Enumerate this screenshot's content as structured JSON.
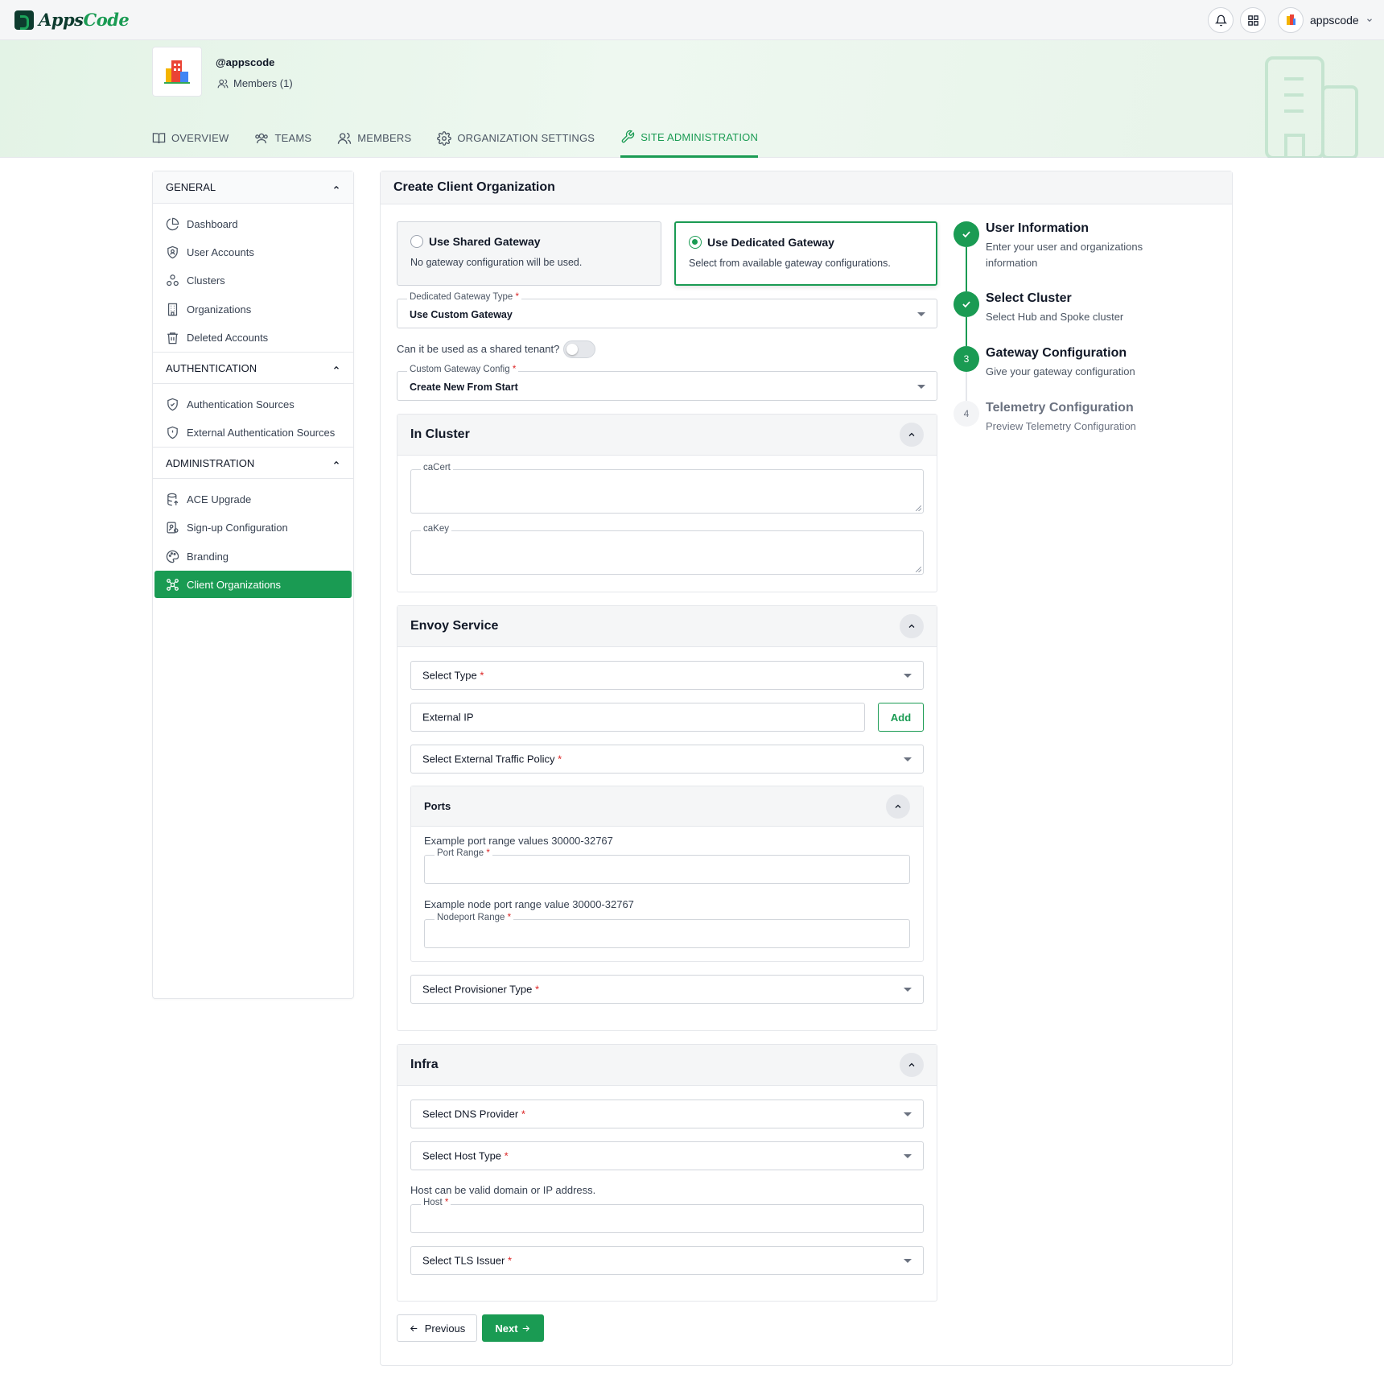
{
  "app": {
    "logo_part1": "Apps",
    "logo_part2": "Code",
    "user": "appscode"
  },
  "org": {
    "handle": "@appscode",
    "members": "Members (1)"
  },
  "nav_tabs": [
    {
      "label": "OVERVIEW",
      "icon": "book-icon"
    },
    {
      "label": "TEAMS",
      "icon": "users-icon"
    },
    {
      "label": "MEMBERS",
      "icon": "user-group-icon"
    },
    {
      "label": "ORGANIZATION SETTINGS",
      "icon": "gear-icon"
    },
    {
      "label": "SITE ADMINISTRATION",
      "icon": "wrench-icon",
      "active": true
    }
  ],
  "sidebar": {
    "general": {
      "title": "GENERAL",
      "items": [
        {
          "label": "Dashboard",
          "icon": "pie-chart-icon"
        },
        {
          "label": "User Accounts",
          "icon": "user-shield-icon"
        },
        {
          "label": "Clusters",
          "icon": "cluster-icon"
        },
        {
          "label": "Organizations",
          "icon": "building-icon"
        },
        {
          "label": "Deleted Accounts",
          "icon": "trash-icon"
        }
      ]
    },
    "authentication": {
      "title": "AUTHENTICATION",
      "items": [
        {
          "label": "Authentication Sources",
          "icon": "shield-check-icon"
        },
        {
          "label": "External Authentication Sources",
          "icon": "shield-icon"
        }
      ]
    },
    "administration": {
      "title": "ADMINISTRATION",
      "items": [
        {
          "label": "ACE Upgrade",
          "icon": "database-upgrade-icon"
        },
        {
          "label": "Sign-up Configuration",
          "icon": "signup-config-icon"
        },
        {
          "label": "Branding",
          "icon": "palette-icon"
        },
        {
          "label": "Client Organizations",
          "icon": "client-orgs-icon",
          "active": true
        }
      ]
    }
  },
  "form": {
    "title": "Create Client Organization",
    "shared": {
      "title": "Use Shared Gateway",
      "desc": "No gateway configuration will be used."
    },
    "dedicated": {
      "title": "Use Dedicated Gateway",
      "desc": "Select from available gateway configurations.",
      "selected": true
    },
    "gateway_type": {
      "label": "Dedicated Gateway Type",
      "value": "Use Custom Gateway"
    },
    "shared_tenant_label": "Can it be used as a shared tenant?",
    "shared_tenant_on": false,
    "custom_config": {
      "label": "Custom Gateway Config",
      "value": "Create New From Start"
    },
    "in_cluster": {
      "title": "In Cluster",
      "ca_cert": "caCert",
      "ca_key": "caKey"
    },
    "envoy": {
      "title": "Envoy Service",
      "select_type": "Select Type",
      "external_ip": "External IP",
      "add": "Add",
      "traffic_policy": "Select External Traffic Policy",
      "ports": {
        "title": "Ports",
        "port_hint": "Example port range values 30000-32767",
        "port_label": "Port Range",
        "node_hint": "Example node port range value 30000-32767",
        "node_label": "Nodeport Range"
      },
      "provisioner": "Select Provisioner Type"
    },
    "infra": {
      "title": "Infra",
      "dns": "Select DNS Provider",
      "host_type": "Select Host Type",
      "host_hint": "Host can be valid domain or IP address.",
      "host_label": "Host",
      "tls": "Select TLS Issuer"
    },
    "previous": "Previous",
    "next": "Next"
  },
  "steps": [
    {
      "title": "User Information",
      "desc": "Enter your user and organizations information",
      "status": "done"
    },
    {
      "title": "Select Cluster",
      "desc": "Select Hub and Spoke cluster",
      "status": "done"
    },
    {
      "number": "3",
      "title": "Gateway Configuration",
      "desc": "Give your gateway configuration",
      "status": "current"
    },
    {
      "number": "4",
      "title": "Telemetry Configuration",
      "desc": "Preview Telemetry Configuration",
      "status": "pending"
    }
  ],
  "colors": {
    "accent": "#1a9b53",
    "required": "#dc2626"
  }
}
